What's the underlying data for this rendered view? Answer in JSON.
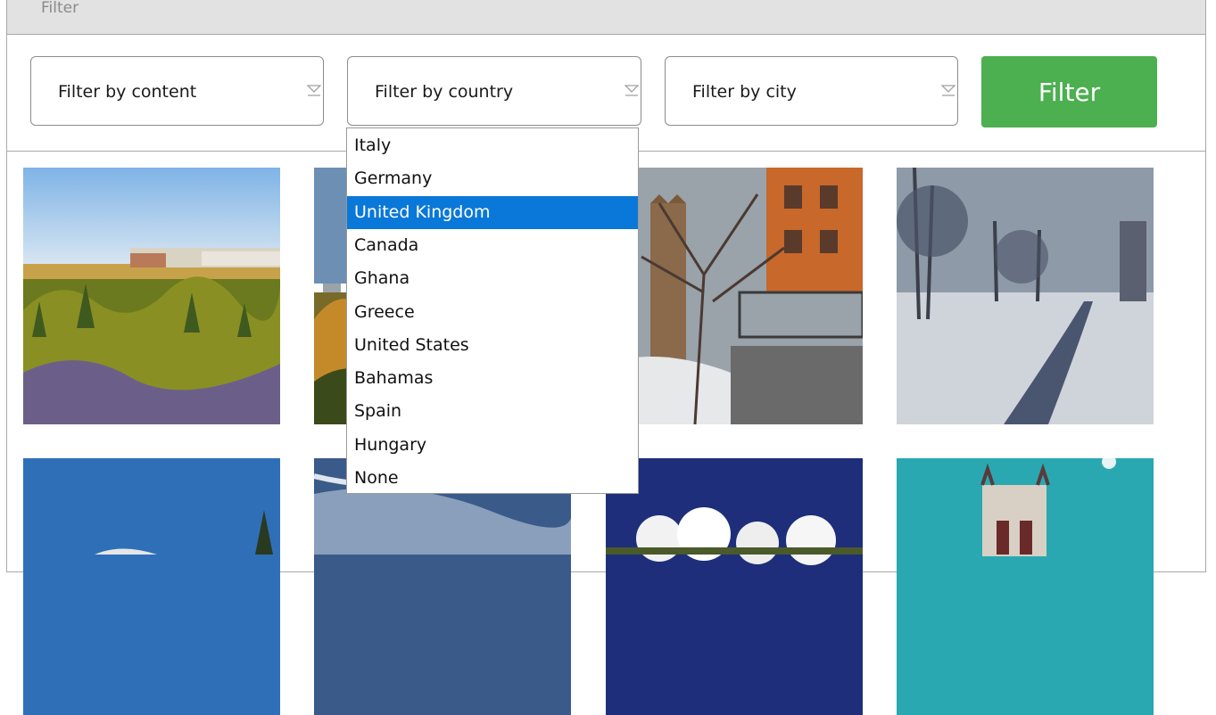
{
  "header": {
    "title": "Filter"
  },
  "filters": {
    "content_placeholder": "Filter by content",
    "country_placeholder": "Filter by country",
    "city_placeholder": "Filter by city",
    "button_label": "Filter"
  },
  "country_dropdown": {
    "options": [
      "Italy",
      "Germany",
      "United Kingdom",
      "Canada",
      "Ghana",
      "Greece",
      "United States",
      "Bahamas",
      "Spain",
      "Hungary",
      "None"
    ],
    "selected": "United Kingdom"
  },
  "gallery": {
    "images": [
      "autumn-forest-with-buildings",
      "autumn-trees-with-city",
      "snowy-brick-church",
      "snowy-park-path",
      "blue-sky-with-pine",
      "cloudy-sky",
      "clouds-over-landscape",
      "gothic-tower"
    ]
  },
  "colors": {
    "accent": "#4caf50",
    "selection": "#0a78d8",
    "header_bg": "#e2e2e2"
  },
  "icons": {
    "select_arrow": "chevron-down-icon"
  }
}
